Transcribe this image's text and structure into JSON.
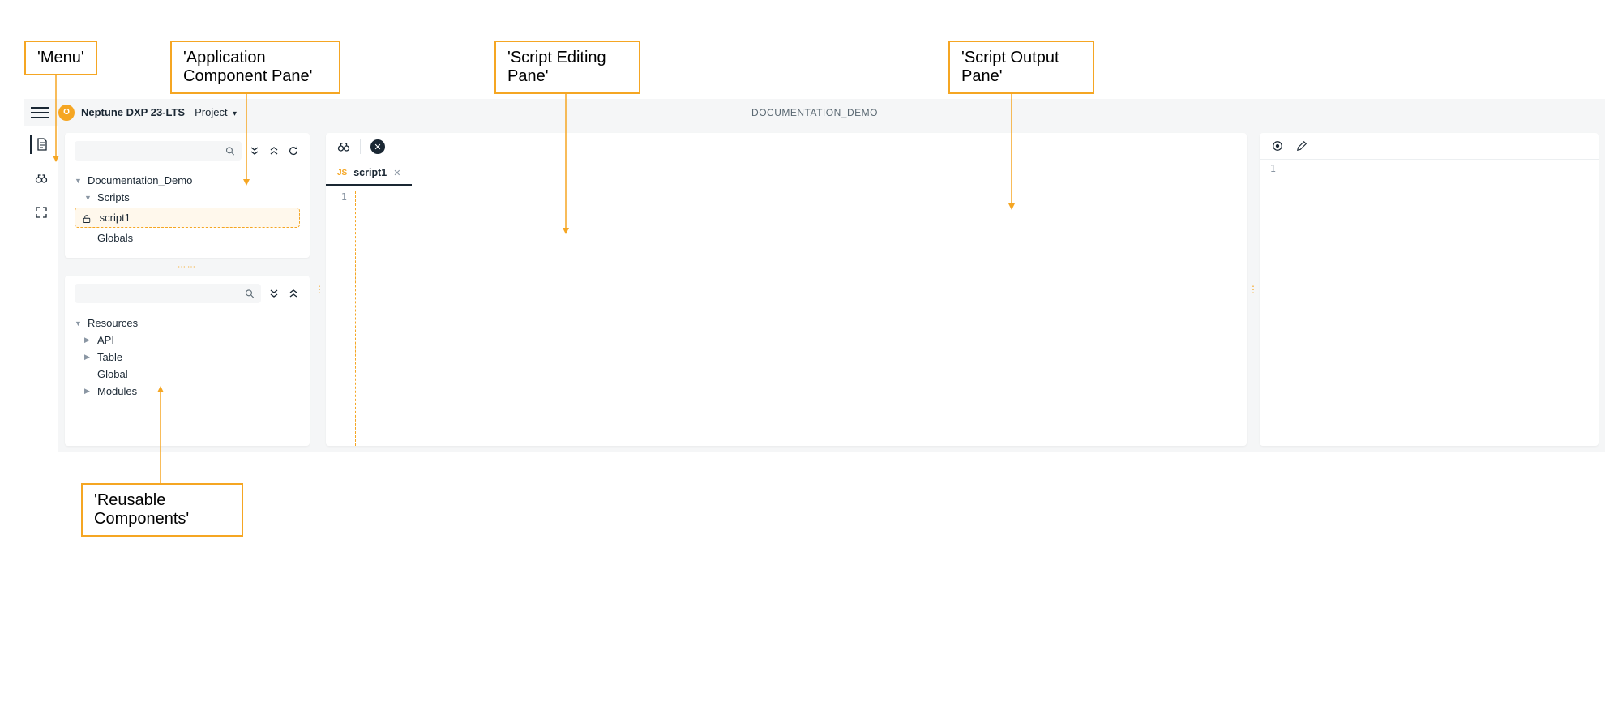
{
  "annotations": {
    "menu": "'Menu'",
    "component_pane": "'Application Component Pane'",
    "editing_pane": "'Script Editing Pane'",
    "output_pane": "'Script Output Pane'",
    "reusable": "'Reusable Components'"
  },
  "header": {
    "brand_initial": "O",
    "brand": "Neptune DXP 23-LTS",
    "project_label": "Project",
    "doc_title": "DOCUMENTATION_DEMO"
  },
  "component_tree": {
    "root": "Documentation_Demo",
    "scripts_label": "Scripts",
    "script_item": "script1",
    "globals_label": "Globals"
  },
  "resources_tree": {
    "root": "Resources",
    "api": "API",
    "table": "Table",
    "global": "Global",
    "modules": "Modules"
  },
  "editor": {
    "tab_lang": "JS",
    "tab_name": "script1",
    "line_no": "1"
  },
  "output": {
    "line_no": "1"
  }
}
